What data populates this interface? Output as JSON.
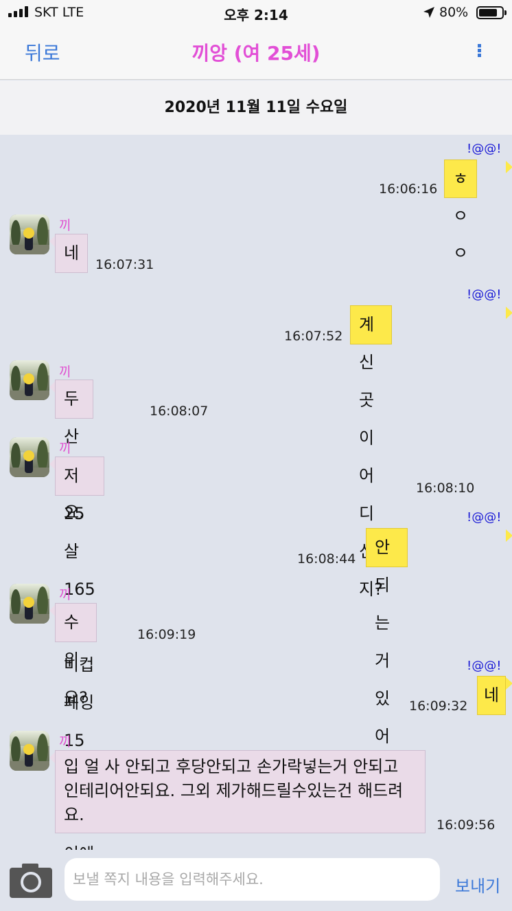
{
  "status_bar": {
    "carrier": "SKT   LTE",
    "time": "오후 2:14",
    "battery": "80%",
    "battery_level": 0.8
  },
  "header": {
    "back_label": "뒤로",
    "title": "끼앙 (여 25세)"
  },
  "date_label": "2020년 11월 11일 수요일",
  "messages": [
    {
      "direction": "out",
      "sender_tag": "!@@!",
      "text": "ㅎㅇㅇ",
      "time": "16:06:16"
    },
    {
      "direction": "in",
      "name": "끼앙",
      "text": "네",
      "time": "16:07:31"
    },
    {
      "direction": "out",
      "sender_tag": "!@@!",
      "text": "계신곳이 어디신지?",
      "time": "16:07:52"
    },
    {
      "direction": "in",
      "name": "끼앙",
      "text": "두산동요.",
      "time": "16:08:07"
    },
    {
      "direction": "in",
      "name": "끼앙",
      "text": "저 25살 165 50 비컵 페잉 15 노컨 18이에요.",
      "time": "16:08:10"
    },
    {
      "direction": "out",
      "sender_tag": "!@@!",
      "text": "안되는거 있어요?",
      "time": "16:08:44"
    },
    {
      "direction": "in",
      "name": "끼앙",
      "text": "수위요?",
      "time": "16:09:19"
    },
    {
      "direction": "out",
      "sender_tag": "!@@!",
      "text": "네",
      "time": "16:09:32"
    },
    {
      "direction": "in",
      "name": "끼앙",
      "text_lines": [
        "입 얼 사 안되고 후당안되고 손가락넣는거 안되고",
        "인테리어안되요. 그외 제가해드릴수있는건 해드려",
        "요."
      ],
      "time": "16:09:56"
    }
  ],
  "composer": {
    "placeholder": "보낼 쪽지 내용을 입력해주세요.",
    "send_label": "보내기"
  },
  "icons": {
    "signal": "cellular-signal-icon",
    "location": "location-arrow-icon",
    "battery": "battery-icon",
    "more": "more-vertical-icon",
    "camera": "camera-icon"
  },
  "colors": {
    "accent": "#3b78d8",
    "title": "#e24fd6",
    "outgoing_bubble": "#fde94a",
    "incoming_bubble": "#eadbe8",
    "sender_tag": "#1a1ad6",
    "chat_bg": "#dfe3ec"
  }
}
